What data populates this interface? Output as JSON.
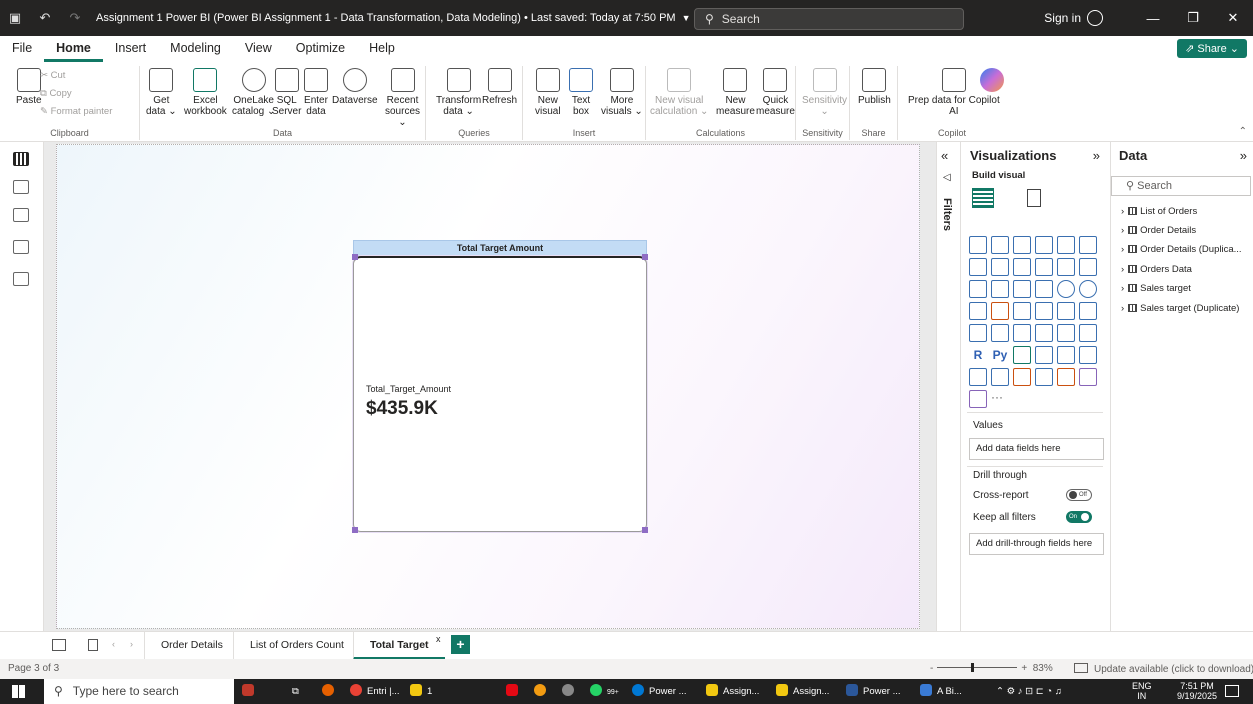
{
  "titlebar": {
    "title": "Assignment 1 Power BI (Power BI Assignment 1 - Data Transformation, Data Modeling) • Last saved: Today at 7:50 PM",
    "search_placeholder": "Search",
    "signin": "Sign in"
  },
  "menu": {
    "tabs": [
      "File",
      "Home",
      "Insert",
      "Modeling",
      "View",
      "Optimize",
      "Help"
    ],
    "active": "Home",
    "share": "Share"
  },
  "ribbon": {
    "clipboard": {
      "paste": "Paste",
      "cut": "Cut",
      "copy": "Copy",
      "format_painter": "Format painter",
      "label": "Clipboard"
    },
    "data": {
      "label": "Data",
      "buttons": [
        {
          "l1": "Get",
          "l2": "data ⌄"
        },
        {
          "l1": "Excel",
          "l2": "workbook"
        },
        {
          "l1": "OneLake",
          "l2": "catalog ⌄"
        },
        {
          "l1": "SQL",
          "l2": "Server"
        },
        {
          "l1": "Enter",
          "l2": "data"
        },
        {
          "l1": "Dataverse",
          "l2": ""
        },
        {
          "l1": "Recent",
          "l2": "sources ⌄"
        }
      ]
    },
    "queries": {
      "label": "Queries",
      "transform_l1": "Transform",
      "transform_l2": "data ⌄",
      "refresh": "Refresh"
    },
    "insert": {
      "label": "Insert",
      "buttons": [
        {
          "l1": "New",
          "l2": "visual"
        },
        {
          "l1": "Text",
          "l2": "box"
        },
        {
          "l1": "More",
          "l2": "visuals ⌄"
        }
      ]
    },
    "calculations": {
      "label": "Calculations",
      "new_visual_calc_l1": "New visual",
      "new_visual_calc_l2": "calculation ⌄",
      "new_measure_l1": "New",
      "new_measure_l2": "measure",
      "quick_measure_l1": "Quick",
      "quick_measure_l2": "measure"
    },
    "sensitivity": {
      "label": "Sensitivity",
      "button": "Sensitivity",
      "button_l2": "⌄"
    },
    "share": {
      "label": "Share",
      "publish": "Publish"
    },
    "copilot": {
      "label": "Copilot",
      "prep_l1": "Prep data for Copilot",
      "prep_l2": "AI"
    }
  },
  "visual": {
    "header": "Total Target Amount",
    "metric_label": "Total_Target_Amount",
    "metric_value": "$435.9K"
  },
  "filters": {
    "label": "Filters"
  },
  "visualizations": {
    "title": "Visualizations",
    "build_label": "Build visual",
    "r_label": "R",
    "py_label": "Py",
    "more": "···",
    "values_label": "Values",
    "values_well": "Add data fields here",
    "drill_label": "Drill through",
    "cross_report": "Cross-report",
    "cross_report_state": "Off",
    "keep_filters": "Keep all filters",
    "keep_filters_state": "On",
    "drill_well": "Add drill-through fields here"
  },
  "data_pane": {
    "title": "Data",
    "search_placeholder": "Search",
    "tables": [
      "List of Orders",
      "Order Details",
      "Order Details (Duplica...",
      "Orders Data",
      "Sales target",
      "Sales target (Duplicate)"
    ]
  },
  "pages": {
    "tabs": [
      "Order Details",
      "List of Orders Count",
      "Total Target"
    ],
    "active": "Total Target",
    "close": "x",
    "add": "+"
  },
  "status": {
    "page_info": "Page 3 of 3",
    "zoom_minus": "-",
    "zoom_plus": "+",
    "zoom": "83%",
    "update": "Update available (click to download)"
  },
  "taskbar": {
    "search_placeholder": "Type here to search",
    "items": [
      {
        "label": "Entri |...",
        "color": "#e94235"
      },
      {
        "label": "1",
        "color": "#f2c811"
      },
      {
        "label": "Power ...",
        "color": "#0078d4"
      },
      {
        "label": "Assign...",
        "color": "#f2c811"
      },
      {
        "label": "Assign...",
        "color": "#f2c811"
      },
      {
        "label": "Power ...",
        "color": "#2b579a"
      },
      {
        "label": "A Bi...",
        "color": "#3a7bd5"
      }
    ],
    "badge": "99+",
    "lang1": "ENG",
    "lang2": "IN",
    "time": "7:51 PM",
    "date": "9/19/2025"
  }
}
